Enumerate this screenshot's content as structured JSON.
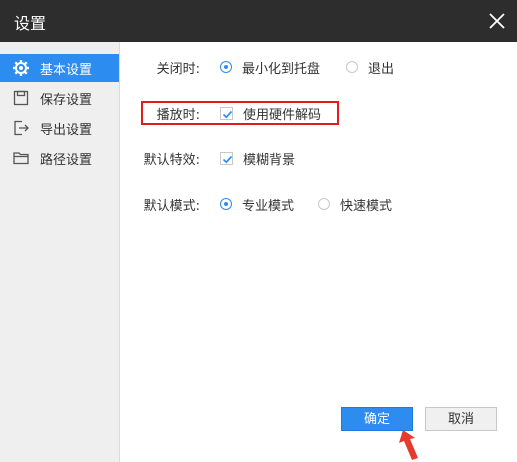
{
  "dialog": {
    "title": "设置"
  },
  "sidebar": {
    "items": [
      {
        "label": "基本设置",
        "icon": "gear-icon",
        "active": true
      },
      {
        "label": "保存设置",
        "icon": "save-icon",
        "active": false
      },
      {
        "label": "导出设置",
        "icon": "export-icon",
        "active": false
      },
      {
        "label": "路径设置",
        "icon": "folder-icon",
        "active": false
      }
    ]
  },
  "settings": {
    "on_close": {
      "label": "关闭时:",
      "options": [
        "最小化到托盘",
        "退出"
      ],
      "selected": "最小化到托盘"
    },
    "playback": {
      "label": "播放时:",
      "checkbox_label": "使用硬件解码",
      "checked": true
    },
    "effects": {
      "label": "默认特效:",
      "checkbox_label": "模糊背景",
      "checked": true
    },
    "mode": {
      "label": "默认模式:",
      "options": [
        "专业模式",
        "快速模式"
      ],
      "selected": "专业模式"
    }
  },
  "buttons": {
    "ok": "确定",
    "cancel": "取消"
  },
  "colors": {
    "accent": "#2d8cf0",
    "titlebar": "#2d2d2d",
    "highlight": "#e31b1b"
  }
}
